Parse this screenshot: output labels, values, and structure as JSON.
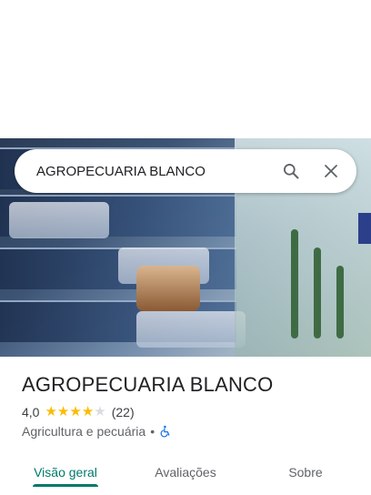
{
  "search": {
    "value": "AGROPECUARIA BLANCO"
  },
  "place": {
    "title": "AGROPECUARIA BLANCO",
    "rating": "4,0",
    "rating_value": 4.0,
    "rating_max": 5,
    "review_count": "(22)",
    "category": "Agricultura e pecuária",
    "separator": "•",
    "accessibility_icon": "wheelchair-icon"
  },
  "tabs": [
    {
      "label": "Visão geral",
      "active": true
    },
    {
      "label": "Avaliações",
      "active": false
    },
    {
      "label": "Sobre",
      "active": false
    }
  ],
  "colors": {
    "accent": "#00796b",
    "star": "#fbbc04",
    "star_empty": "#dadce0",
    "accessibility": "#1a73e8"
  }
}
